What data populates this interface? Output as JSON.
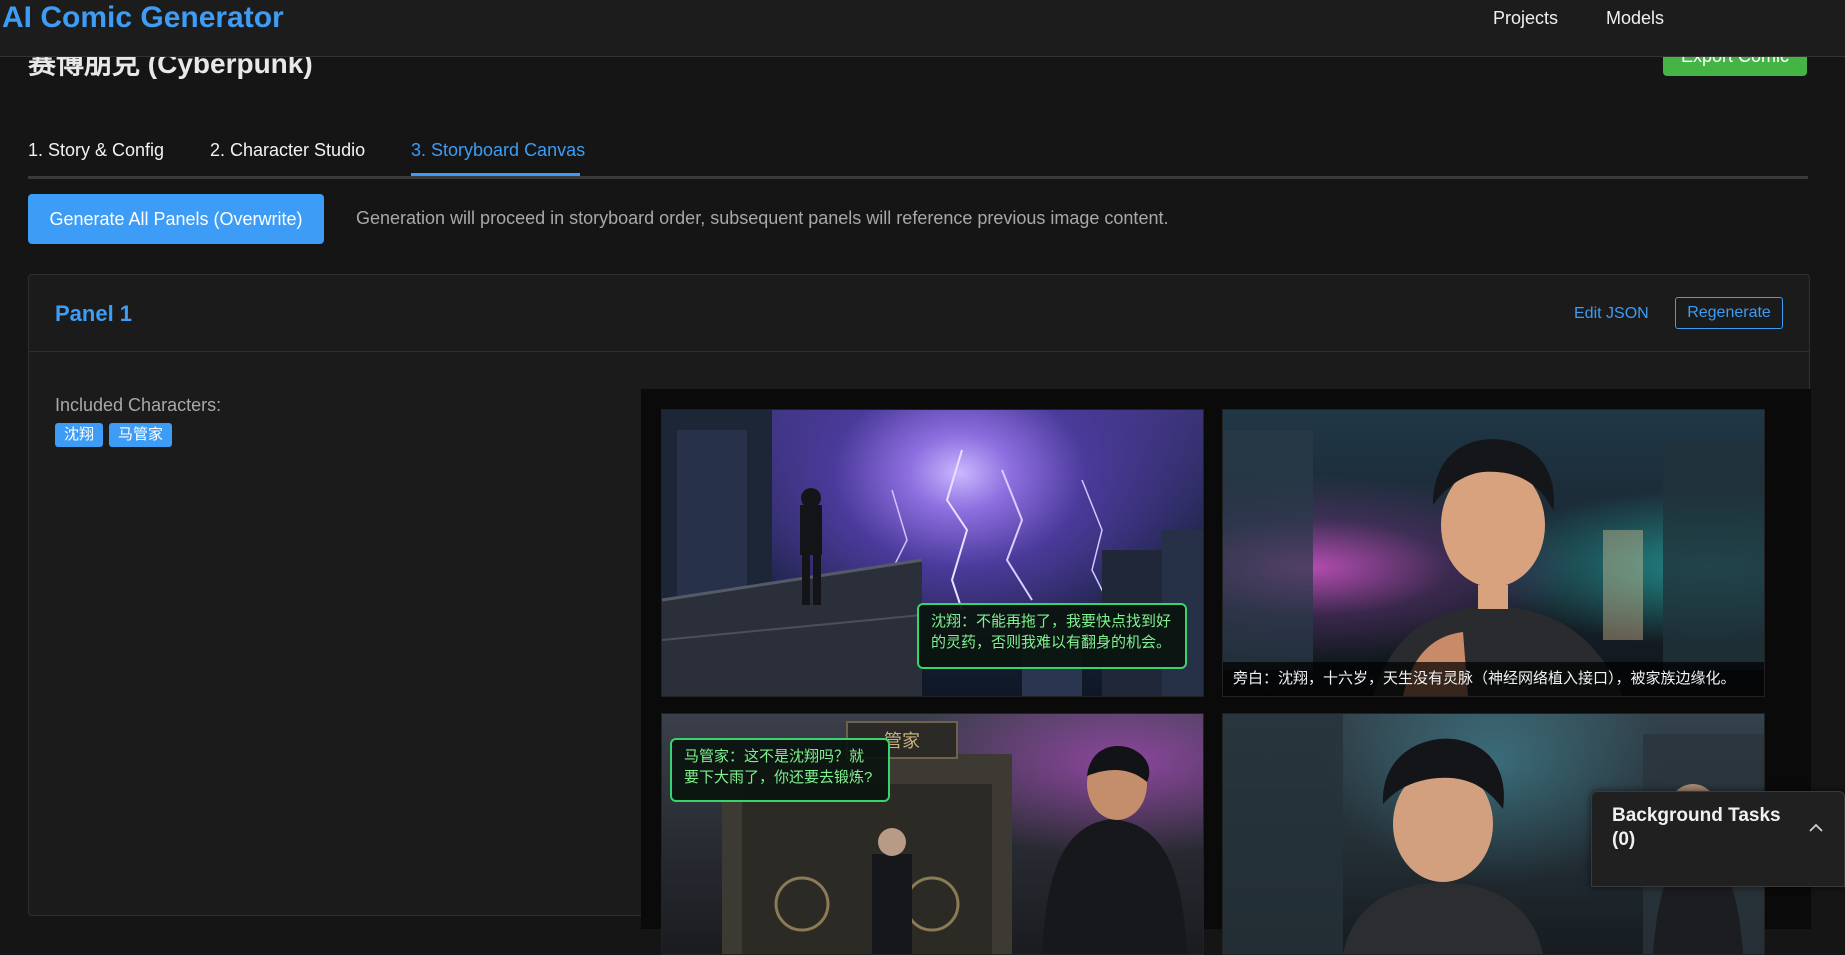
{
  "app": {
    "title": "AI Comic Generator",
    "nav": [
      "Projects",
      "Models"
    ],
    "accent": "#3d9cf5",
    "success": "#44b445"
  },
  "page": {
    "title": "赛博朋克 (Cyberpunk)",
    "export_label": "Export Comic"
  },
  "tabs": [
    {
      "label": "1. Story & Config",
      "active": false
    },
    {
      "label": "2. Character Studio",
      "active": false
    },
    {
      "label": "3. Storyboard Canvas",
      "active": true
    }
  ],
  "generate": {
    "button_label": "Generate All Panels (Overwrite)",
    "hint": "Generation will proceed in storyboard order, subsequent panels will reference previous image content."
  },
  "panel": {
    "title": "Panel 1",
    "edit_json_label": "Edit JSON",
    "regenerate_label": "Regenerate",
    "included_label": "Included Characters:",
    "characters": [
      "沈翔",
      "马管家"
    ],
    "frames": {
      "frame1_bubble": "沈翔：不能再拖了，我要快点找到好的灵药，否则我难以有翻身的机会。",
      "frame2_caption": "旁白：沈翔，十六岁，天生没有灵脉（神经网络植入接口），被家族边缘化。",
      "frame3_bubble": "马管家：这不是沈翔吗？就要下大雨了，你还要去锻炼?",
      "frame3_sign": "管家"
    }
  },
  "background_tasks": {
    "label": "Background Tasks (0)"
  }
}
